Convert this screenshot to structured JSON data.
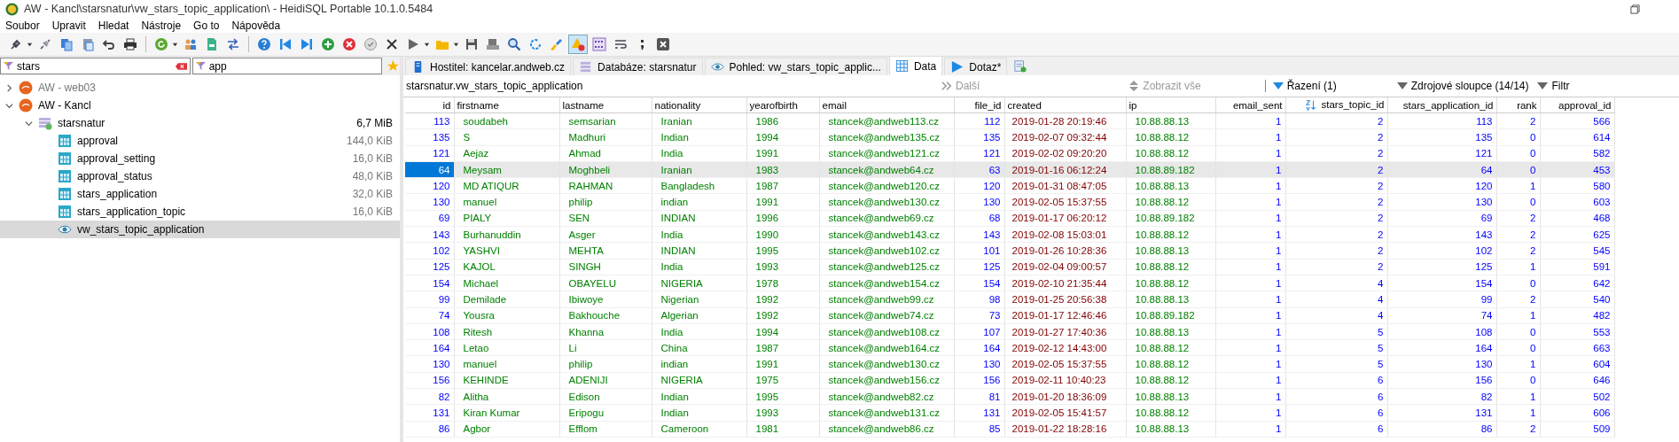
{
  "window": {
    "title": "AW - Kancl\\starsnatur\\vw_stars_topic_application\\ - HeidiSQL Portable 10.1.0.5484"
  },
  "menu": [
    "Soubor",
    "Upravit",
    "Hledat",
    "Nástroje",
    "Go to",
    "Nápověda"
  ],
  "filters": [
    {
      "value": "stars",
      "clearable": true
    },
    {
      "value": "app",
      "clearable": false
    }
  ],
  "tree": [
    {
      "label": "AW - web03",
      "kind": "server",
      "connected": false,
      "expanded": false,
      "selected": false
    },
    {
      "label": "AW - Kancl",
      "kind": "server",
      "connected": true,
      "expanded": true,
      "selected": false,
      "children": [
        {
          "label": "starsnatur",
          "kind": "database",
          "size": "6,7 MiB",
          "expanded": true,
          "selected": false,
          "children": [
            {
              "label": "approval",
              "kind": "table",
              "size": "144,0 KiB",
              "selected": false
            },
            {
              "label": "approval_setting",
              "kind": "table",
              "size": "16,0 KiB",
              "selected": false
            },
            {
              "label": "approval_status",
              "kind": "table",
              "size": "48,0 KiB",
              "selected": false
            },
            {
              "label": "stars_application",
              "kind": "table",
              "size": "32,0 KiB",
              "selected": false
            },
            {
              "label": "stars_application_topic",
              "kind": "table",
              "size": "16,0 KiB",
              "selected": false
            },
            {
              "label": "vw_stars_topic_application",
              "kind": "view",
              "selected": true
            }
          ]
        }
      ]
    }
  ],
  "tabs": [
    {
      "label": "Hostitel: kancelar.andweb.cz",
      "kind": "host",
      "selected": false
    },
    {
      "label": "Databáze: starsnatur",
      "kind": "database",
      "selected": false
    },
    {
      "label": "Pohled: vw_stars_topic_applic...",
      "kind": "view",
      "selected": false
    },
    {
      "label": "Data",
      "kind": "data",
      "selected": true
    },
    {
      "label": "Dotaz*",
      "kind": "query",
      "selected": false
    }
  ],
  "data_title": "starsnatur.vw_stars_topic_application",
  "data_actions": [
    {
      "label": "Další",
      "kind": "next",
      "disabled": true
    },
    {
      "label": "Zobrazit vše",
      "kind": "showall",
      "disabled": true
    },
    {
      "label": "Řazení (1)",
      "kind": "sort",
      "disabled": false
    },
    {
      "label": "Zdrojové sloupce (14/14)",
      "kind": "columns",
      "disabled": false
    },
    {
      "label": "Filtr",
      "kind": "filter",
      "disabled": false
    }
  ],
  "table": {
    "columns": [
      {
        "name": "id",
        "kind": "int",
        "sorted": false
      },
      {
        "name": "firstname",
        "kind": "text",
        "sorted": false
      },
      {
        "name": "lastname",
        "kind": "text",
        "sorted": false
      },
      {
        "name": "nationality",
        "kind": "text",
        "sorted": false
      },
      {
        "name": "yearofbirth",
        "kind": "text",
        "sorted": false
      },
      {
        "name": "email",
        "kind": "text",
        "sorted": false
      },
      {
        "name": "file_id",
        "kind": "int",
        "sorted": false
      },
      {
        "name": "created",
        "kind": "date",
        "sorted": false
      },
      {
        "name": "ip",
        "kind": "text",
        "sorted": false
      },
      {
        "name": "email_sent",
        "kind": "int",
        "sorted": false
      },
      {
        "name": "stars_topic_id",
        "kind": "int",
        "sorted": true
      },
      {
        "name": "stars_application_id",
        "kind": "int",
        "sorted": false
      },
      {
        "name": "rank",
        "kind": "int",
        "sorted": false
      },
      {
        "name": "approval_id",
        "kind": "int",
        "sorted": false
      }
    ],
    "rows": [
      {
        "selected": false,
        "cells": [
          "113",
          "soudabeh",
          "semsarian",
          "Iranian",
          "1986",
          "stancek@andweb113.cz",
          "112",
          "2019-01-28 20:19:46",
          "10.88.88.13",
          "1",
          "2",
          "113",
          "2",
          "566"
        ]
      },
      {
        "selected": false,
        "cells": [
          "135",
          "S",
          "Madhuri",
          "Indian",
          "1994",
          "stancek@andweb135.cz",
          "135",
          "2019-02-07 09:32:44",
          "10.88.88.12",
          "1",
          "2",
          "135",
          "0",
          "614"
        ]
      },
      {
        "selected": false,
        "cells": [
          "121",
          "Aejaz",
          "Ahmad",
          "India",
          "1991",
          "stancek@andweb121.cz",
          "121",
          "2019-02-02 09:20:20",
          "10.88.88.12",
          "1",
          "2",
          "121",
          "0",
          "582"
        ]
      },
      {
        "selected": true,
        "cells": [
          "64",
          "Meysam",
          "Moghbeli",
          "Iranian",
          "1983",
          "stancek@andweb64.cz",
          "63",
          "2019-01-16 06:12:24",
          "10.88.89.182",
          "1",
          "2",
          "64",
          "0",
          "453"
        ]
      },
      {
        "selected": false,
        "cells": [
          "120",
          "MD ATIQUR",
          "RAHMAN",
          "Bangladesh",
          "1987",
          "stancek@andweb120.cz",
          "120",
          "2019-01-31 08:47:05",
          "10.88.88.13",
          "1",
          "2",
          "120",
          "1",
          "580"
        ]
      },
      {
        "selected": false,
        "cells": [
          "130",
          "manuel",
          "philip",
          "indian",
          "1991",
          "stancek@andweb130.cz",
          "130",
          "2019-02-05 15:37:55",
          "10.88.88.12",
          "1",
          "2",
          "130",
          "0",
          "603"
        ]
      },
      {
        "selected": false,
        "cells": [
          "69",
          "PIALY",
          "SEN",
          "INDIAN",
          "1996",
          "stancek@andweb69.cz",
          "68",
          "2019-01-17 06:20:12",
          "10.88.89.182",
          "1",
          "2",
          "69",
          "2",
          "468"
        ]
      },
      {
        "selected": false,
        "cells": [
          "143",
          "Burhanuddin",
          "Asger",
          "India",
          "1990",
          "stancek@andweb143.cz",
          "143",
          "2019-02-08 15:03:01",
          "10.88.88.12",
          "1",
          "2",
          "143",
          "2",
          "625"
        ]
      },
      {
        "selected": false,
        "cells": [
          "102",
          "YASHVI",
          "MEHTA",
          "INDIAN",
          "1995",
          "stancek@andweb102.cz",
          "101",
          "2019-01-26 10:28:36",
          "10.88.88.13",
          "1",
          "2",
          "102",
          "2",
          "545"
        ]
      },
      {
        "selected": false,
        "cells": [
          "125",
          "KAJOL",
          "SINGH",
          "India",
          "1993",
          "stancek@andweb125.cz",
          "125",
          "2019-02-04 09:00:57",
          "10.88.88.12",
          "1",
          "2",
          "125",
          "1",
          "591"
        ]
      },
      {
        "selected": false,
        "cells": [
          "154",
          "Michael",
          "OBAYELU",
          "NIGERIA",
          "1978",
          "stancek@andweb154.cz",
          "154",
          "2019-02-10 21:35:44",
          "10.88.88.12",
          "1",
          "4",
          "154",
          "0",
          "642"
        ]
      },
      {
        "selected": false,
        "cells": [
          "99",
          "Demilade",
          "Ibiwoye",
          "Nigerian",
          "1992",
          "stancek@andweb99.cz",
          "98",
          "2019-01-25 20:56:38",
          "10.88.88.13",
          "1",
          "4",
          "99",
          "2",
          "540"
        ]
      },
      {
        "selected": false,
        "cells": [
          "74",
          "Yousra",
          "Bakhouche",
          "Algerian",
          "1992",
          "stancek@andweb74.cz",
          "73",
          "2019-01-17 12:46:46",
          "10.88.89.182",
          "1",
          "4",
          "74",
          "1",
          "482"
        ]
      },
      {
        "selected": false,
        "cells": [
          "108",
          "Ritesh",
          "Khanna",
          "India",
          "1994",
          "stancek@andweb108.cz",
          "107",
          "2019-01-27 17:40:36",
          "10.88.88.13",
          "1",
          "5",
          "108",
          "0",
          "553"
        ]
      },
      {
        "selected": false,
        "cells": [
          "164",
          "Letao",
          "Li",
          "China",
          "1987",
          "stancek@andweb164.cz",
          "164",
          "2019-02-12 14:43:00",
          "10.88.88.12",
          "1",
          "5",
          "164",
          "0",
          "663"
        ]
      },
      {
        "selected": false,
        "cells": [
          "130",
          "manuel",
          "philip",
          "indian",
          "1991",
          "stancek@andweb130.cz",
          "130",
          "2019-02-05 15:37:55",
          "10.88.88.12",
          "1",
          "5",
          "130",
          "1",
          "604"
        ]
      },
      {
        "selected": false,
        "cells": [
          "156",
          "KEHINDE",
          "ADENIJI",
          "NIGERIA",
          "1975",
          "stancek@andweb156.cz",
          "156",
          "2019-02-11 10:40:23",
          "10.88.88.12",
          "1",
          "6",
          "156",
          "0",
          "646"
        ]
      },
      {
        "selected": false,
        "cells": [
          "82",
          "Alitha",
          "Edison",
          "Indian",
          "1995",
          "stancek@andweb82.cz",
          "81",
          "2019-01-20 18:36:09",
          "10.88.88.13",
          "1",
          "6",
          "82",
          "1",
          "502"
        ]
      },
      {
        "selected": false,
        "cells": [
          "131",
          "Kiran Kumar",
          "Eripogu",
          "Indian",
          "1993",
          "stancek@andweb131.cz",
          "131",
          "2019-02-05 15:41:57",
          "10.88.88.12",
          "1",
          "6",
          "131",
          "1",
          "606"
        ]
      },
      {
        "selected": false,
        "cells": [
          "86",
          "Agbor",
          "Efflom",
          "Cameroon",
          "1981",
          "stancek@andweb86.cz",
          "85",
          "2019-01-22 18:28:16",
          "10.88.88.13",
          "1",
          "6",
          "86",
          "2",
          "509"
        ]
      }
    ]
  }
}
